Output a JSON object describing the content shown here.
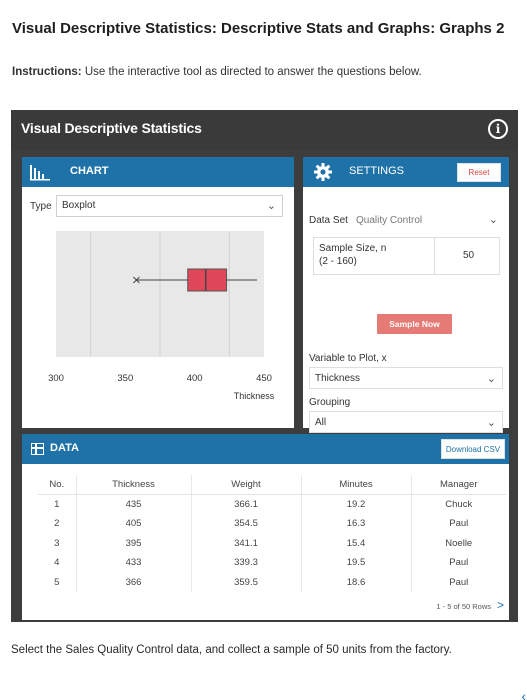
{
  "page": {
    "title": "Visual Descriptive Statistics: Descriptive Stats and Graphs: Graphs 2",
    "instructions_label": "Instructions:",
    "instructions_text": " Use the interactive tool as directed to answer the questions below.",
    "task": "Select the Sales Quality Control data, and collect a sample of 50 units from the factory."
  },
  "tool": {
    "title": "Visual Descriptive Statistics",
    "info_icon": "i"
  },
  "chart": {
    "header": "CHART",
    "type_label": "Type",
    "type_value": "Boxplot",
    "axis_label": "Thickness",
    "ticks": [
      300,
      350,
      400,
      450
    ]
  },
  "chart_data": {
    "type": "boxplot",
    "orientation": "horizontal",
    "xlabel": "Thickness",
    "xlim": [
      300,
      450
    ],
    "min": 358,
    "q1": 395,
    "median": 408,
    "q3": 423,
    "max": 445,
    "grid": true,
    "colors": {
      "box": "#e0485a",
      "plot_bg": "#e8e8e8"
    }
  },
  "settings": {
    "header": "SETTINGS",
    "reset_label": "Reset",
    "dataset_label": "Data Set",
    "dataset_value": "Quality Control",
    "sample_size_label_1": "Sample Size, n",
    "sample_size_label_2": "(2 - 160)",
    "sample_size_value": "50",
    "sample_button": "Sample Now",
    "variable_label": "Variable to Plot, x",
    "variable_value": "Thickness",
    "grouping_label": "Grouping",
    "grouping_value": "All"
  },
  "data": {
    "header": "DATA",
    "csv_button": "Download CSV",
    "columns": [
      "No.",
      "Thickness",
      "Weight",
      "Minutes",
      "Manager"
    ],
    "rows": [
      [
        "1",
        "435",
        "366.1",
        "19.2",
        "Chuck"
      ],
      [
        "2",
        "405",
        "354.5",
        "16.3",
        "Paul"
      ],
      [
        "3",
        "395",
        "341.1",
        "15.4",
        "Noelle"
      ],
      [
        "4",
        "433",
        "339.3",
        "19.5",
        "Paul"
      ],
      [
        "5",
        "366",
        "359.5",
        "18.6",
        "Paul"
      ]
    ],
    "pager_text": "1 - 5 of 50 Rows",
    "pager_next": ">"
  },
  "colors": {
    "accent": "#1f72a8",
    "dark": "#3d3d3d",
    "button": "#e67a75"
  }
}
